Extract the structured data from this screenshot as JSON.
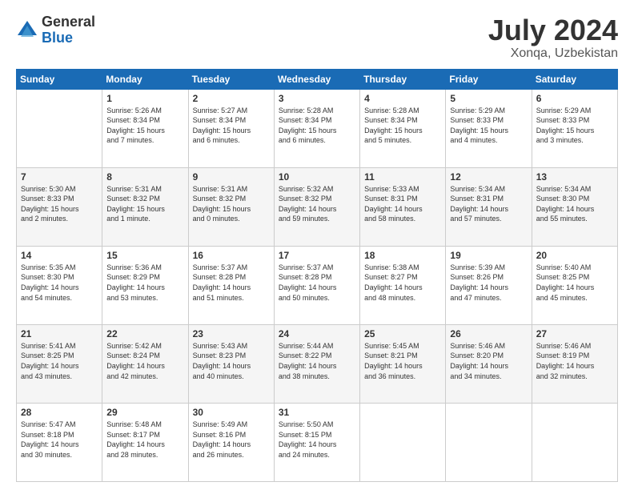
{
  "logo": {
    "general": "General",
    "blue": "Blue"
  },
  "title": "July 2024",
  "location": "Xonqa, Uzbekistan",
  "days_of_week": [
    "Sunday",
    "Monday",
    "Tuesday",
    "Wednesday",
    "Thursday",
    "Friday",
    "Saturday"
  ],
  "weeks": [
    [
      {
        "day": "",
        "info": ""
      },
      {
        "day": "1",
        "info": "Sunrise: 5:26 AM\nSunset: 8:34 PM\nDaylight: 15 hours\nand 7 minutes."
      },
      {
        "day": "2",
        "info": "Sunrise: 5:27 AM\nSunset: 8:34 PM\nDaylight: 15 hours\nand 6 minutes."
      },
      {
        "day": "3",
        "info": "Sunrise: 5:28 AM\nSunset: 8:34 PM\nDaylight: 15 hours\nand 6 minutes."
      },
      {
        "day": "4",
        "info": "Sunrise: 5:28 AM\nSunset: 8:34 PM\nDaylight: 15 hours\nand 5 minutes."
      },
      {
        "day": "5",
        "info": "Sunrise: 5:29 AM\nSunset: 8:33 PM\nDaylight: 15 hours\nand 4 minutes."
      },
      {
        "day": "6",
        "info": "Sunrise: 5:29 AM\nSunset: 8:33 PM\nDaylight: 15 hours\nand 3 minutes."
      }
    ],
    [
      {
        "day": "7",
        "info": "Sunrise: 5:30 AM\nSunset: 8:33 PM\nDaylight: 15 hours\nand 2 minutes."
      },
      {
        "day": "8",
        "info": "Sunrise: 5:31 AM\nSunset: 8:32 PM\nDaylight: 15 hours\nand 1 minute."
      },
      {
        "day": "9",
        "info": "Sunrise: 5:31 AM\nSunset: 8:32 PM\nDaylight: 15 hours\nand 0 minutes."
      },
      {
        "day": "10",
        "info": "Sunrise: 5:32 AM\nSunset: 8:32 PM\nDaylight: 14 hours\nand 59 minutes."
      },
      {
        "day": "11",
        "info": "Sunrise: 5:33 AM\nSunset: 8:31 PM\nDaylight: 14 hours\nand 58 minutes."
      },
      {
        "day": "12",
        "info": "Sunrise: 5:34 AM\nSunset: 8:31 PM\nDaylight: 14 hours\nand 57 minutes."
      },
      {
        "day": "13",
        "info": "Sunrise: 5:34 AM\nSunset: 8:30 PM\nDaylight: 14 hours\nand 55 minutes."
      }
    ],
    [
      {
        "day": "14",
        "info": "Sunrise: 5:35 AM\nSunset: 8:30 PM\nDaylight: 14 hours\nand 54 minutes."
      },
      {
        "day": "15",
        "info": "Sunrise: 5:36 AM\nSunset: 8:29 PM\nDaylight: 14 hours\nand 53 minutes."
      },
      {
        "day": "16",
        "info": "Sunrise: 5:37 AM\nSunset: 8:28 PM\nDaylight: 14 hours\nand 51 minutes."
      },
      {
        "day": "17",
        "info": "Sunrise: 5:37 AM\nSunset: 8:28 PM\nDaylight: 14 hours\nand 50 minutes."
      },
      {
        "day": "18",
        "info": "Sunrise: 5:38 AM\nSunset: 8:27 PM\nDaylight: 14 hours\nand 48 minutes."
      },
      {
        "day": "19",
        "info": "Sunrise: 5:39 AM\nSunset: 8:26 PM\nDaylight: 14 hours\nand 47 minutes."
      },
      {
        "day": "20",
        "info": "Sunrise: 5:40 AM\nSunset: 8:25 PM\nDaylight: 14 hours\nand 45 minutes."
      }
    ],
    [
      {
        "day": "21",
        "info": "Sunrise: 5:41 AM\nSunset: 8:25 PM\nDaylight: 14 hours\nand 43 minutes."
      },
      {
        "day": "22",
        "info": "Sunrise: 5:42 AM\nSunset: 8:24 PM\nDaylight: 14 hours\nand 42 minutes."
      },
      {
        "day": "23",
        "info": "Sunrise: 5:43 AM\nSunset: 8:23 PM\nDaylight: 14 hours\nand 40 minutes."
      },
      {
        "day": "24",
        "info": "Sunrise: 5:44 AM\nSunset: 8:22 PM\nDaylight: 14 hours\nand 38 minutes."
      },
      {
        "day": "25",
        "info": "Sunrise: 5:45 AM\nSunset: 8:21 PM\nDaylight: 14 hours\nand 36 minutes."
      },
      {
        "day": "26",
        "info": "Sunrise: 5:46 AM\nSunset: 8:20 PM\nDaylight: 14 hours\nand 34 minutes."
      },
      {
        "day": "27",
        "info": "Sunrise: 5:46 AM\nSunset: 8:19 PM\nDaylight: 14 hours\nand 32 minutes."
      }
    ],
    [
      {
        "day": "28",
        "info": "Sunrise: 5:47 AM\nSunset: 8:18 PM\nDaylight: 14 hours\nand 30 minutes."
      },
      {
        "day": "29",
        "info": "Sunrise: 5:48 AM\nSunset: 8:17 PM\nDaylight: 14 hours\nand 28 minutes."
      },
      {
        "day": "30",
        "info": "Sunrise: 5:49 AM\nSunset: 8:16 PM\nDaylight: 14 hours\nand 26 minutes."
      },
      {
        "day": "31",
        "info": "Sunrise: 5:50 AM\nSunset: 8:15 PM\nDaylight: 14 hours\nand 24 minutes."
      },
      {
        "day": "",
        "info": ""
      },
      {
        "day": "",
        "info": ""
      },
      {
        "day": "",
        "info": ""
      }
    ]
  ]
}
